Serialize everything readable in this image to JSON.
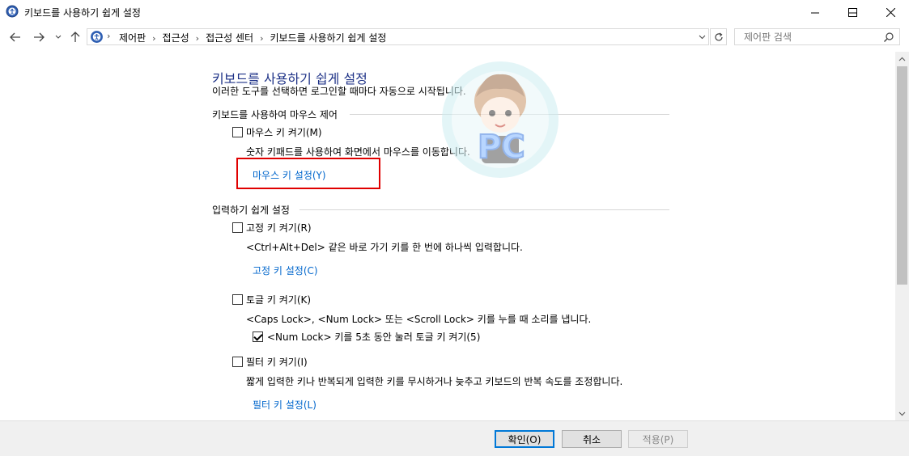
{
  "window": {
    "title": "키보드를 사용하기 쉽게 설정",
    "icon": "ease-of-access-icon"
  },
  "nav": {
    "breadcrumbs": [
      "제어판",
      "접근성",
      "접근성 센터",
      "키보드를 사용하기 쉽게 설정"
    ],
    "search_placeholder": "제어판 검색"
  },
  "page": {
    "heading": "키보드를 사용하기 쉽게 설정",
    "subtitle": "이러한 도구를 선택하면 로그인할 때마다 자동으로 시작됩니다."
  },
  "mouse_group": {
    "label": "키보드를 사용하여 마우스 제어",
    "mouse_keys": {
      "label": "마우스 키 켜기(M)",
      "checked": false,
      "description": "숫자 키패드를 사용하여 화면에서 마우스를 이동합니다.",
      "link": "마우스 키 설정(Y)"
    }
  },
  "typing_group": {
    "label": "입력하기 쉽게 설정",
    "sticky_keys": {
      "label": "고정 키 켜기(R)",
      "checked": false,
      "description": "<Ctrl+Alt+Del> 같은 바로 가기 키를 한 번에 하나씩 입력합니다.",
      "link": "고정 키 설정(C)"
    },
    "toggle_keys": {
      "label": "토글 키 켜기(K)",
      "checked": false,
      "description": "<Caps Lock>, <Num Lock> 또는 <Scroll Lock> 키를 누를 때 소리를 냅니다.",
      "sub_option": {
        "label": "<Num Lock> 키를 5초 동안 눌러 토글 키 켜기(5)",
        "checked": true
      }
    },
    "filter_keys": {
      "label": "필터 키 켜기(I)",
      "checked": false,
      "description": "짧게 입력한 키나 반복되게 입력한 키를 무시하거나 늦추고 키보드의 반복 속도를 조정합니다.",
      "link": "필터 키 설정(L)"
    }
  },
  "footer": {
    "ok": "확인(O)",
    "cancel": "취소",
    "apply": "적용(P)"
  },
  "watermark": {
    "text": "PC"
  },
  "colors": {
    "heading": "#1e3287",
    "link": "#0066cc",
    "highlight": "#e00000"
  }
}
